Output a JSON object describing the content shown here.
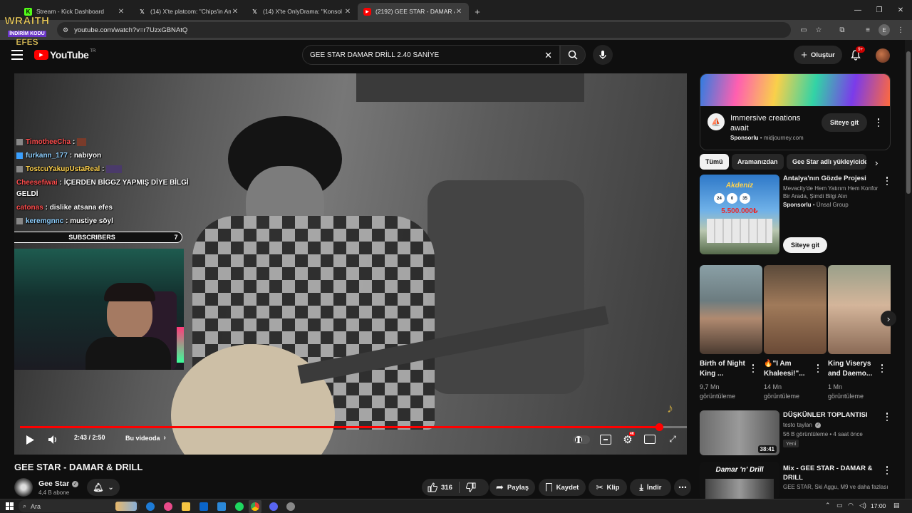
{
  "browser": {
    "tabs": [
      {
        "title": "Stream - Kick Dashboard",
        "icon": "kick-icon",
        "active": false
      },
      {
        "title": "(14) X'te platcom: \"Chips'in Am",
        "icon": "x-icon",
        "active": false
      },
      {
        "title": "(14) X'te OnlyDrama: \"Konsol O",
        "icon": "x-icon",
        "active": false
      },
      {
        "title": "(2192) GEE STAR - DAMAR & D",
        "icon": "youtube-icon",
        "active": true
      }
    ],
    "url": "youtube.com/watch?v=r7UzxGBNAtQ",
    "profile_initial": "E"
  },
  "overlay_logo": {
    "line1": "WRAITH",
    "line2": "İNDİRİM KODU",
    "line3": "EFES"
  },
  "youtube": {
    "logo_text": "YouTube",
    "logo_region": "TR",
    "search_value": "GEE STAR DAMAR DRİLL 2.40 SANİYE",
    "create_label": "Oluştur",
    "notif_badge": "9+"
  },
  "chat": [
    {
      "user": "TimotheeCha",
      "text": "",
      "color": "#ff4d4d",
      "sep": ":"
    },
    {
      "user": "furkann_177",
      "text": "nabıyon",
      "color": "#8fd0ff",
      "sep": ":"
    },
    {
      "user": "TostcuYakupUstaReal",
      "text": "",
      "color": "#ffd24d",
      "sep": ":"
    },
    {
      "user": "Cheesefiwai",
      "text": "İÇERDEN BİGGZ YAPMIŞ DİYE BİLGİ",
      "color": "#ff4d4d",
      "sep": ":"
    },
    {
      "user": "",
      "text": "GELDİ",
      "color": "#ffffff",
      "sep": ""
    },
    {
      "user": "catonas",
      "text": "dislike atsana efes",
      "color": "#ff4d4d",
      "sep": ":"
    },
    {
      "user": "keremgnnc",
      "text": "mustiye söyl",
      "color": "#8fd0ff",
      "sep": ":"
    }
  ],
  "subscribers": {
    "label": "SUBSCRIBERS",
    "current": "0",
    "goal": "7"
  },
  "player": {
    "time": "2:43 / 2:50",
    "progress_fraction": 0.958,
    "in_video_label": "Bu videoda",
    "quality_badge": "4K"
  },
  "video": {
    "title": "GEE STAR - DAMAR & DRILL",
    "channel": "Gee Star",
    "subscribers": "4,4 B abone",
    "likes": "316",
    "share": "Paylaş",
    "save": "Kaydet",
    "clip": "Klip",
    "download": "İndir"
  },
  "sidebar": {
    "ad_top": {
      "title": "Immersive creations await",
      "sponsor": "Sponsorlu",
      "domain": "midjourney.com",
      "cta": "Siteye git"
    },
    "chips": [
      "Tümü",
      "Aramanızdan",
      "Gee Star adlı yükleyiciden"
    ],
    "ad_card": {
      "title": "Antalya'nın Gözde Projesi",
      "desc": "Mevacity'de Hem Yatırım Hem Konfor Bir Arada, Şimdi Bilgi Alın",
      "sponsor": "Sponsorlu",
      "advertiser": "Ünsal Group",
      "cta": "Siteye git",
      "thumb_brand": "Akdeniz",
      "thumb_price": "5.500.000₺",
      "counts": [
        "24",
        "0",
        "35"
      ]
    },
    "shorts": [
      {
        "title": "Birth of Night King ...",
        "views": "9,7 Mn görüntüleme"
      },
      {
        "title": "🔥\"I Am Khaleesi!\"...",
        "views": "14 Mn görüntüleme"
      },
      {
        "title": "King Viserys and Daemo...",
        "views": "1 Mn görüntüleme"
      }
    ],
    "videos": [
      {
        "title": "DÜŞKÜNLER TOPLANTISI",
        "channel": "testo taylan",
        "meta": "56 B görüntüleme • 4 saat önce",
        "badge": "Yeni",
        "duration": "38:41"
      },
      {
        "title": "Mix - GEE STAR - DAMAR & DRILL",
        "channel": "GEE STAR, Ski Aggu, M9 ve daha fazlası",
        "meta": "",
        "badge": "",
        "duration": "",
        "thumb_text": "Damar 'n' Drill"
      }
    ]
  },
  "taskbar": {
    "search_placeholder": "Ara",
    "time": "17:00"
  },
  "colors": {
    "accent_red": "#ff0000",
    "bg": "#0f0f0f",
    "chip": "#272727"
  }
}
